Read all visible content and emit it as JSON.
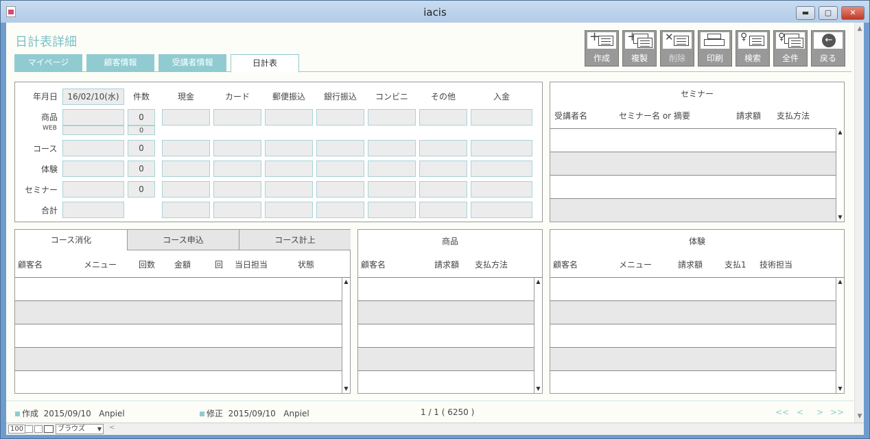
{
  "window": {
    "title": "iacis",
    "minimize": "▬",
    "maximize": "▢",
    "close": "✕"
  },
  "page_title": "日計表詳細",
  "nav_tabs": [
    "マイページ",
    "顧客情報",
    "受講者情報",
    "日計表"
  ],
  "toolbar": [
    {
      "label": "作成",
      "icon": "plus-doc-icon"
    },
    {
      "label": "複製",
      "icon": "duplicate-icon"
    },
    {
      "label": "削除",
      "icon": "delete-doc-icon"
    },
    {
      "label": "印刷",
      "icon": "printer-icon"
    },
    {
      "label": "検索",
      "icon": "search-doc-icon"
    },
    {
      "label": "全件",
      "icon": "all-records-icon"
    },
    {
      "label": "戻る",
      "icon": "back-arrow-icon"
    }
  ],
  "summary": {
    "date_label": "年月日",
    "date_value": "16/02/10(水)",
    "count_header": "件数",
    "columns": [
      "現金",
      "カード",
      "郵便振込",
      "銀行振込",
      "コンビニ",
      "その他",
      "入金"
    ],
    "rows": [
      {
        "label": "商品",
        "count": "0"
      },
      {
        "label": "WEB",
        "count": "0"
      },
      {
        "label": "コース",
        "count": "0"
      },
      {
        "label": "体験",
        "count": "0"
      },
      {
        "label": "セミナー",
        "count": "0"
      },
      {
        "label": "合計",
        "count": ""
      }
    ]
  },
  "seminar": {
    "title": "セミナー",
    "columns": [
      "受講者名",
      "セミナー名 or 摘要",
      "請求額",
      "支払方法"
    ]
  },
  "course": {
    "tabs": [
      "コース消化",
      "コース申込",
      "コース計上"
    ],
    "columns": [
      "顧客名",
      "メニュー",
      "回数",
      "金額",
      "回",
      "当日担当",
      "状態"
    ]
  },
  "product": {
    "title": "商品",
    "columns": [
      "顧客名",
      "請求額",
      "支払方法"
    ]
  },
  "trial": {
    "title": "体験",
    "columns": [
      "顧客名",
      "メニュー",
      "請求額",
      "支払1",
      "技術担当"
    ]
  },
  "footer": {
    "created_label": "作成",
    "created_date": "2015/09/10",
    "created_by": "Anpiel",
    "modified_label": "修正",
    "modified_date": "2015/09/10",
    "modified_by": "Anpiel",
    "record_info": "1 / 1 ( 6250 )",
    "nav": [
      "<<",
      "<",
      ">",
      ">>"
    ]
  },
  "statusbar": {
    "zoom": "100",
    "mode": "ブラウズ"
  },
  "colors": {
    "accent": "#8fcbd0",
    "title": "#7cc0c8",
    "button": "#999999",
    "field": "#ececec"
  }
}
